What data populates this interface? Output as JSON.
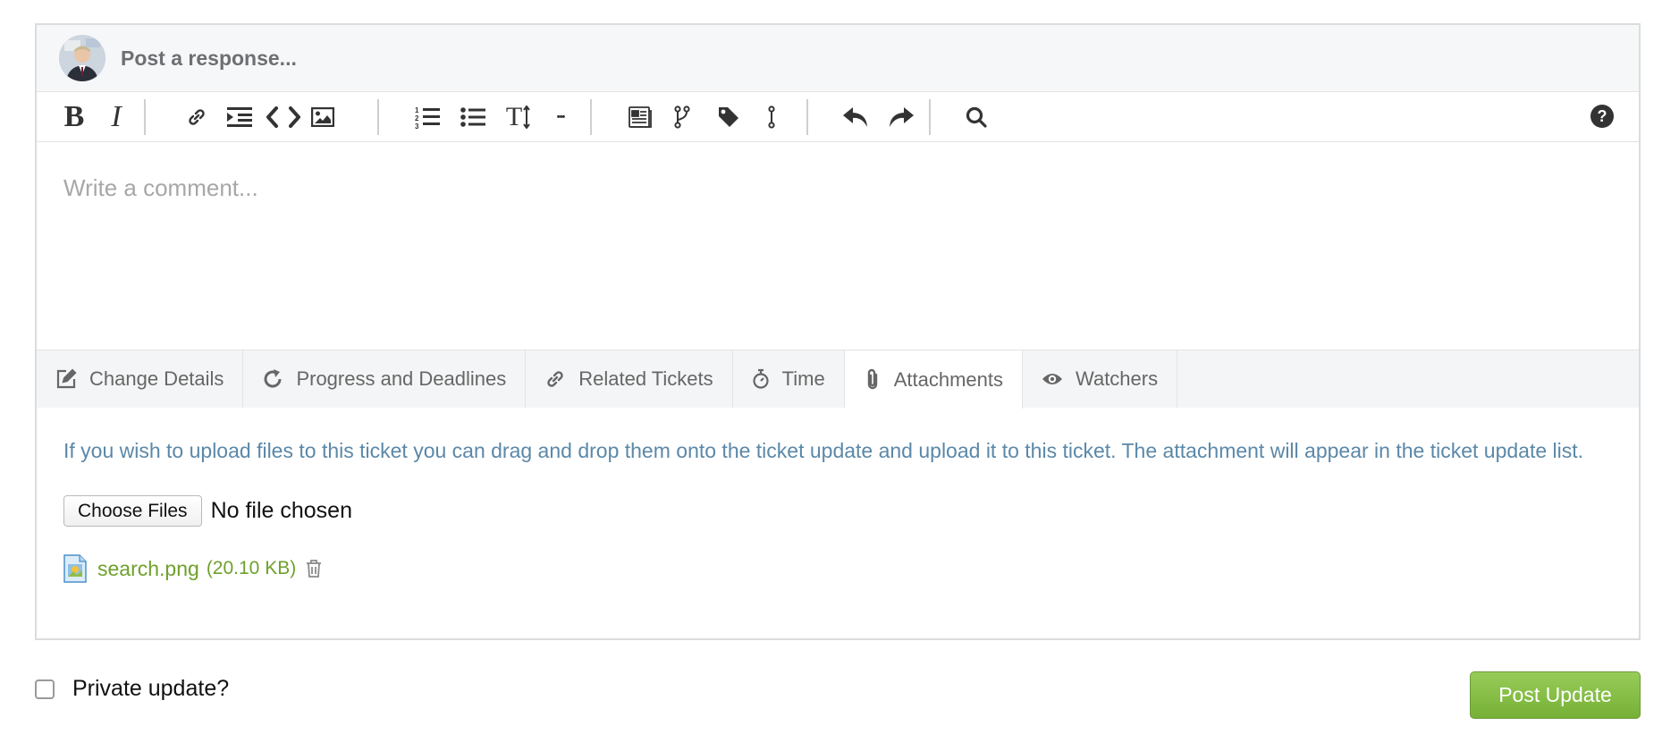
{
  "header": {
    "title": "Post a response..."
  },
  "toolbar": {
    "bold": "B",
    "italic": "I",
    "text_size": "T",
    "more": "•••",
    "help": "?"
  },
  "comment": {
    "placeholder": "Write a comment..."
  },
  "tabs": [
    {
      "label": "Change Details",
      "icon": "edit-icon"
    },
    {
      "label": "Progress and Deadlines",
      "icon": "refresh-icon"
    },
    {
      "label": "Related Tickets",
      "icon": "link-icon"
    },
    {
      "label": "Time",
      "icon": "stopwatch-icon"
    },
    {
      "label": "Attachments",
      "icon": "paperclip-icon",
      "active": true
    },
    {
      "label": "Watchers",
      "icon": "eye-icon"
    }
  ],
  "attachments": {
    "info": "If you wish to upload files to this ticket you can drag and drop them onto the ticket update and upload it to this ticket. The attachment will appear in the ticket update list.",
    "choose_files": "Choose Files",
    "no_file": "No file chosen",
    "file": {
      "name": "search.png",
      "size": "(20.10 KB)"
    }
  },
  "footer": {
    "private_label": "Private update?",
    "post_button": "Post Update"
  },
  "colors": {
    "link_text": "#5b88a8",
    "file_text": "#6ea12b",
    "post_button": "#83bd44"
  }
}
